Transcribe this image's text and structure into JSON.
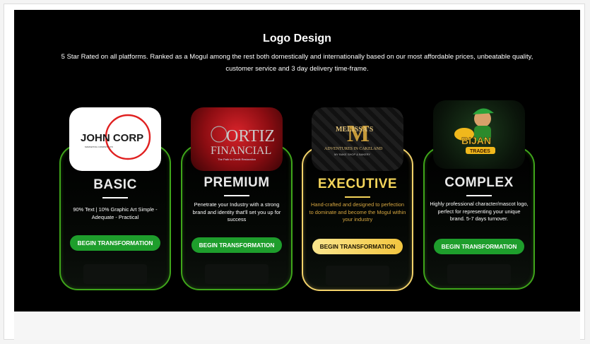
{
  "section": {
    "title": "Logo Design",
    "subtitle": "5 Star Rated on all platforms. Ranked as a Mogul among the rest both domestically and internationally based on our most affordable prices, unbeatable quality, customer service and 3 day delivery time-frame."
  },
  "cards": [
    {
      "name": "BASIC",
      "description": "90% Text | 10% Graphic Art Simple - Adequate - Practical",
      "button": "BEGIN TRANSFORMATION",
      "logo": {
        "text": "JOHN CORP",
        "subtext": "MARKETING COMPANY LTD"
      }
    },
    {
      "name": "PREMIUM",
      "description": "Penetrate your Industry with a strong brand and identity that'll set you up for success",
      "button": "BEGIN TRANSFORMATION",
      "logo": {
        "text": "ORTIZ",
        "text2": "FINANCIAL",
        "subtext": "The Path to Credit Restoration"
      }
    },
    {
      "name": "EXECUTIVE",
      "description": "Hand-crafted and designed to perfection to dominate and become the Mogul within your industry",
      "button": "BEGIN TRANSFORMATION",
      "logo": {
        "text": "M",
        "text2": "MELISSA'S",
        "text3": "ADVENTURES IN CAKELAND",
        "subtext": "MY BAKE SHOP & BAKERY"
      }
    },
    {
      "name": "COMPLEX",
      "description": "Highly professional character/mascot logo, perfect for representing your unique brand. 5-7 days turnover.",
      "button": "BEGIN TRANSFORMATION",
      "logo": {
        "text": "BIJAN",
        "text2": "TRADES"
      }
    }
  ],
  "colors": {
    "green_accent": "#3fa51a",
    "button_green": "#1e9e2c",
    "gold_accent": "#f2d26a",
    "executive_title": "#f3d45a",
    "executive_text": "#d6a640"
  }
}
